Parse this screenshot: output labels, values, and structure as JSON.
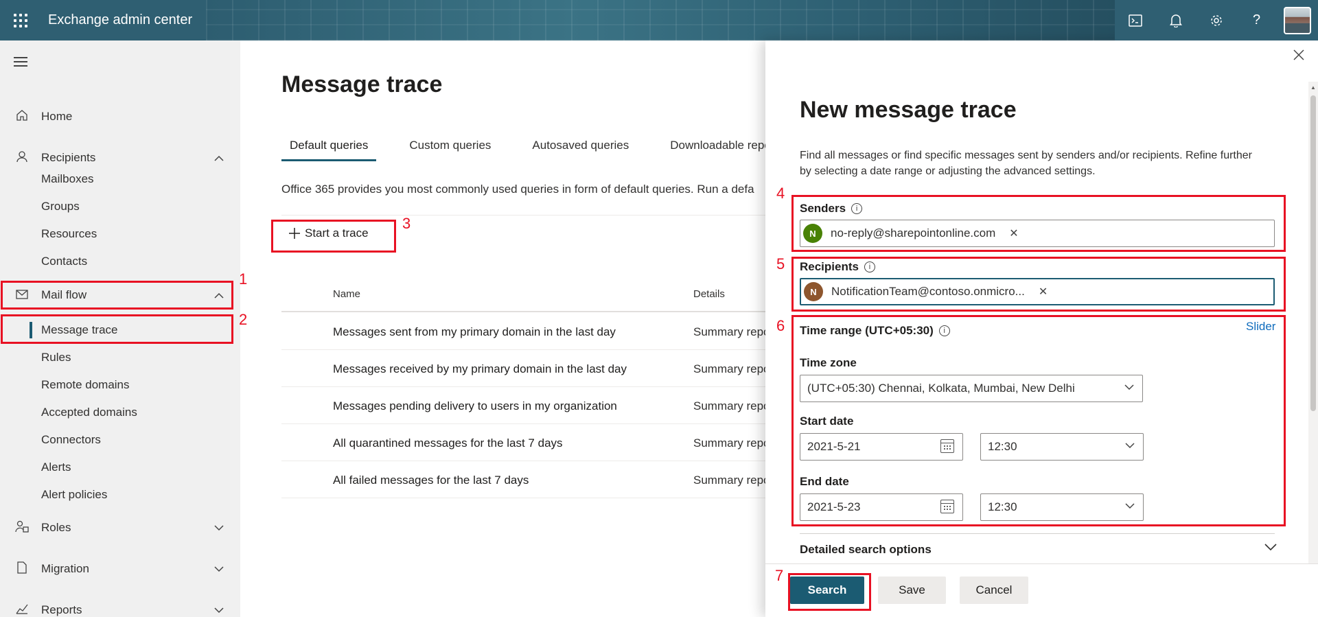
{
  "header": {
    "app_title": "Exchange admin center",
    "icons": [
      "app-launcher-icon",
      "cloud-shell-icon",
      "bell-icon",
      "gear-icon",
      "help-icon"
    ],
    "help_glyph": "?"
  },
  "sidebar": {
    "items": [
      {
        "label": "Home",
        "icon": "home-icon"
      },
      {
        "label": "Recipients",
        "icon": "person-icon"
      },
      {
        "label": "Mailboxes"
      },
      {
        "label": "Groups"
      },
      {
        "label": "Resources"
      },
      {
        "label": "Contacts"
      },
      {
        "label": "Mail flow",
        "icon": "mail-icon"
      },
      {
        "label": "Message trace"
      },
      {
        "label": "Rules"
      },
      {
        "label": "Remote domains"
      },
      {
        "label": "Accepted domains"
      },
      {
        "label": "Connectors"
      },
      {
        "label": "Alerts"
      },
      {
        "label": "Alert policies"
      },
      {
        "label": "Roles",
        "icon": "roles-icon"
      },
      {
        "label": "Migration",
        "icon": "migration-icon"
      },
      {
        "label": "Reports",
        "icon": "reports-icon"
      }
    ]
  },
  "main": {
    "title": "Message trace",
    "tabs": [
      "Default queries",
      "Custom queries",
      "Autosaved queries",
      "Downloadable reports"
    ],
    "description": "Office 365 provides you most commonly used queries in form of default queries. Run a defa",
    "start_trace_label": "Start a trace",
    "columns": {
      "name": "Name",
      "details": "Details"
    },
    "rows": [
      {
        "name": "Messages sent from my primary domain in the last day",
        "details": "Summary repo"
      },
      {
        "name": "Messages received by my primary domain in the last day",
        "details": "Summary repo"
      },
      {
        "name": "Messages pending delivery to users in my organization",
        "details": "Summary repo"
      },
      {
        "name": "All quarantined messages for the last 7 days",
        "details": "Summary repo"
      },
      {
        "name": "All failed messages for the last 7 days",
        "details": "Summary repo"
      }
    ]
  },
  "panel": {
    "title": "New message trace",
    "description": "Find all messages or find specific messages sent by senders and/or recipients. Refine further by selecting a date range or adjusting the advanced settings.",
    "senders_label": "Senders",
    "sender": {
      "initial": "N",
      "email": "no-reply@sharepointonline.com",
      "color": "#498205"
    },
    "recipients_label": "Recipients",
    "recipient": {
      "initial": "N",
      "email": "NotificationTeam@contoso.onmicro...",
      "color": "#8e562e"
    },
    "time_range_label": "Time range (UTC+05:30)",
    "slider_link": "Slider",
    "time_zone_label": "Time zone",
    "time_zone_value": "(UTC+05:30) Chennai, Kolkata, Mumbai, New Delhi",
    "start_date_label": "Start date",
    "start_date": "2021-5-21",
    "start_time": "12:30",
    "end_date_label": "End date",
    "end_date": "2021-5-23",
    "end_time": "12:30",
    "detailed_options_label": "Detailed search options",
    "buttons": {
      "search": "Search",
      "save": "Save",
      "cancel": "Cancel"
    }
  },
  "annotations": [
    "1",
    "2",
    "3",
    "4",
    "5",
    "6",
    "7"
  ],
  "colors": {
    "accent": "#1b5b72",
    "highlight": "#e81123",
    "header_bg": "#2f5f72"
  }
}
